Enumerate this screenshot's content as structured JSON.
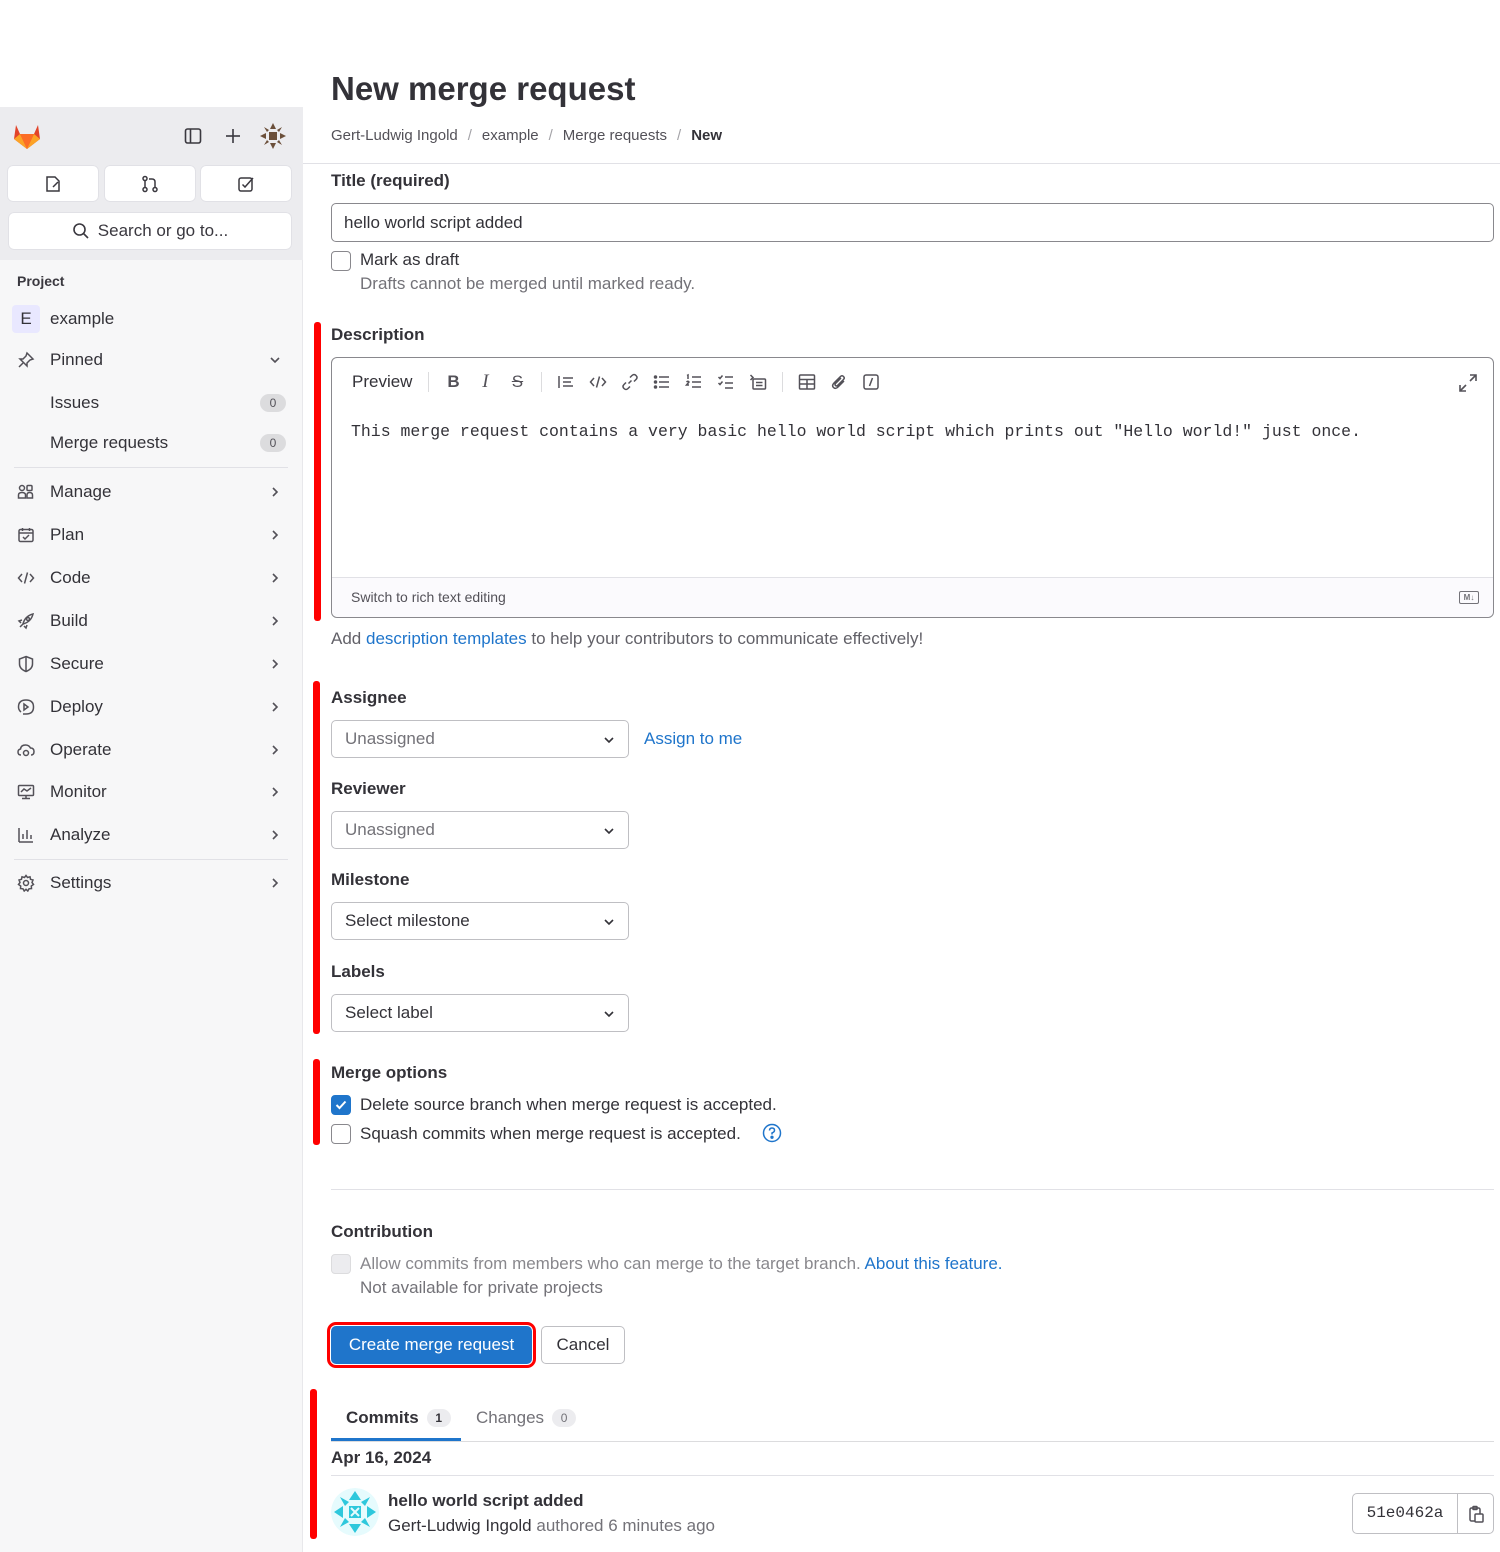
{
  "sidebar": {
    "search_label": "Search or go to...",
    "section_heading": "Project",
    "project": {
      "initial": "E",
      "name": "example"
    },
    "pinned_label": "Pinned",
    "pinned_items": [
      {
        "label": "Issues",
        "count": "0"
      },
      {
        "label": "Merge requests",
        "count": "0"
      }
    ],
    "nav": [
      {
        "label": "Manage",
        "icon": "users-icon"
      },
      {
        "label": "Plan",
        "icon": "calendar-icon"
      },
      {
        "label": "Code",
        "icon": "code-icon"
      },
      {
        "label": "Build",
        "icon": "rocket-icon"
      },
      {
        "label": "Secure",
        "icon": "shield-icon"
      },
      {
        "label": "Deploy",
        "icon": "deploy-icon"
      },
      {
        "label": "Operate",
        "icon": "cloud-gear-icon"
      },
      {
        "label": "Monitor",
        "icon": "monitor-icon"
      },
      {
        "label": "Analyze",
        "icon": "chart-icon"
      }
    ],
    "settings_label": "Settings"
  },
  "page": {
    "title": "New merge request",
    "breadcrumb": [
      "Gert-Ludwig Ingold",
      "example",
      "Merge requests",
      "New"
    ]
  },
  "form": {
    "title_label": "Title (required)",
    "title_value": "hello world script added",
    "draft_label": "Mark as draft",
    "draft_help": "Drafts cannot be merged until marked ready.",
    "description_label": "Description",
    "preview_label": "Preview",
    "description_value": "This merge request contains a very basic hello world script which prints out \"Hello world!\" just once.",
    "switch_rich_label": "Switch to rich text editing",
    "md_badge": "M↓",
    "templates_prefix": "Add ",
    "templates_link": "description templates",
    "templates_suffix": " to help your contributors to communicate effectively!",
    "assignee_label": "Assignee",
    "assignee_value": "Unassigned",
    "assign_to_me": "Assign to me",
    "reviewer_label": "Reviewer",
    "reviewer_value": "Unassigned",
    "milestone_label": "Milestone",
    "milestone_value": "Select milestone",
    "labels_label": "Labels",
    "labels_value": "Select label",
    "merge_options_label": "Merge options",
    "delete_branch_label": "Delete source branch when merge request is accepted.",
    "delete_branch_checked": true,
    "squash_label": "Squash commits when merge request is accepted.",
    "squash_checked": false,
    "contribution_label": "Contribution",
    "allow_commits_label": "Allow commits from members who can merge to the target branch.",
    "about_feature_link": "About this feature.",
    "not_available_text": "Not available for private projects",
    "create_button": "Create merge request",
    "cancel_button": "Cancel"
  },
  "tabs": [
    {
      "label": "Commits",
      "count": "1",
      "active": true
    },
    {
      "label": "Changes",
      "count": "0",
      "active": false
    }
  ],
  "commits": {
    "date": "Apr 16, 2024",
    "items": [
      {
        "title": "hello world script added",
        "author": "Gert-Ludwig Ingold",
        "meta": "authored 6 minutes ago",
        "sha": "51e0462a"
      }
    ]
  },
  "colors": {
    "accent": "#1f75cb",
    "highlight": "#ff0000",
    "gitlab_orange": "#e24329"
  }
}
